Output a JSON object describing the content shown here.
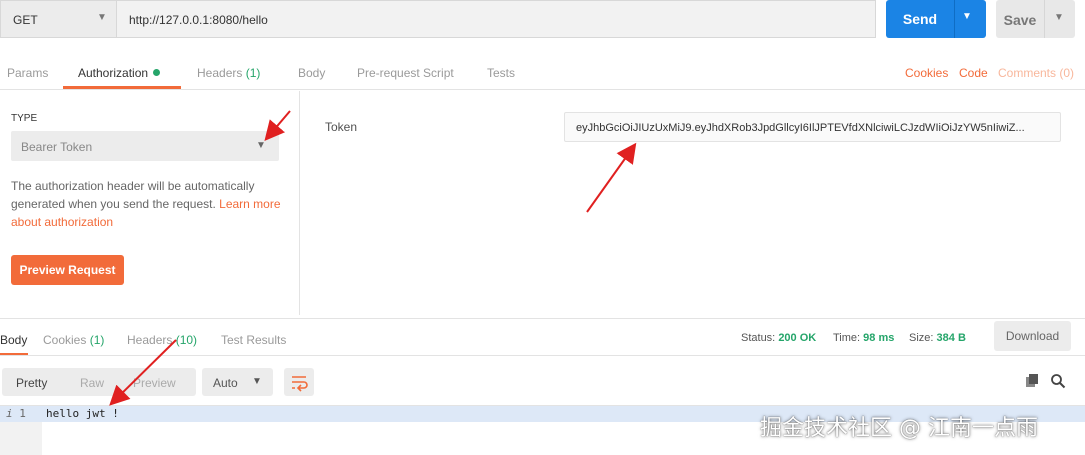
{
  "request": {
    "method": "GET",
    "url": "http://127.0.0.1:8080/hello",
    "send_label": "Send",
    "save_label": "Save"
  },
  "tabs": [
    {
      "label": "Params"
    },
    {
      "label": "Authorization"
    },
    {
      "label": "Headers",
      "count": "(1)"
    },
    {
      "label": "Body"
    },
    {
      "label": "Pre-request Script"
    },
    {
      "label": "Tests"
    }
  ],
  "right_links": {
    "cookies": "Cookies",
    "code": "Code",
    "comments": "Comments (0)"
  },
  "auth": {
    "type_label": "TYPE",
    "type_value": "Bearer Token",
    "description": "The authorization header will be automatically generated when you send the request. ",
    "learn_more": "Learn more about authorization",
    "preview_button": "Preview Request",
    "token_label": "Token",
    "token_value": "eyJhbGciOiJIUzUxMiJ9.eyJhdXRob3JpdGllcyI6IlJPTEVfdXNlciwiLCJzdWIiOiJzYW5nIiwiZ..."
  },
  "response": {
    "tabs": [
      {
        "label": "Body"
      },
      {
        "label": "Cookies",
        "count": "(1)"
      },
      {
        "label": "Headers",
        "count": "(10)"
      },
      {
        "label": "Test Results"
      }
    ],
    "status_label": "Status:",
    "status_value": "200 OK",
    "time_label": "Time:",
    "time_value": "98 ms",
    "size_label": "Size:",
    "size_value": "384 B",
    "download_label": "Download",
    "view_modes": [
      "Pretty",
      "Raw",
      "Preview"
    ],
    "format": "Auto",
    "line_number": "1",
    "body_text": "hello jwt !"
  },
  "watermark": "掘金技术社区 @ 江南一点雨",
  "colors": {
    "accent": "#f26b3a",
    "send": "#1b84e5",
    "success": "#25a56a",
    "arrow": "#e02020"
  },
  "icons": [
    "chevron-down-icon",
    "wrap-icon",
    "copy-icon",
    "search-icon",
    "fold-icon"
  ]
}
